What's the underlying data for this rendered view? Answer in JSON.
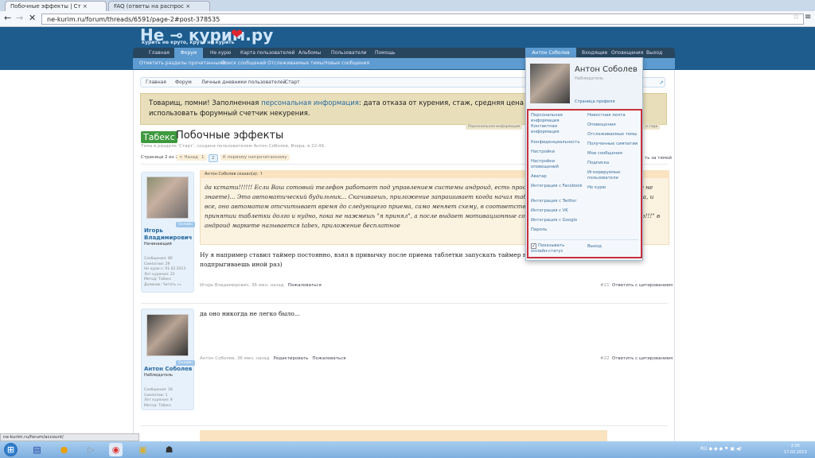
{
  "browser": {
    "tabs": [
      "Побочные эффекты | Ст",
      "FAQ (ответы на распрос"
    ],
    "url": "ne-kurim.ru/forum/threads/6591/page-2#post-378535",
    "status_url": "ne-kurim.ru/forum/account/"
  },
  "site": {
    "logo": "Не ⊸ курим.ру",
    "slogan": "курить не круто, круто не курить"
  },
  "nav": [
    "Главная",
    "Форум",
    "Не курю",
    "Карта пользователей",
    "Альбомы",
    "Пользователи",
    "Помощь"
  ],
  "user_nav": {
    "user": "Антон Соболев",
    "inbox": "Входящие",
    "alerts": "Оповещения",
    "logout": "Выход"
  },
  "subnav": [
    "Отметить разделы прочитанными",
    "Поиск сообщений",
    "Отслеживаемые темы",
    "Новые сообщения"
  ],
  "breadcrumb": [
    "Главная",
    "Форум",
    "Личные дневники пользователей",
    "Старт"
  ],
  "notice": {
    "before": "Товарищ, помни! Заполненная ",
    "link": "персональная информация",
    "after": ": дата отказа от курения, стаж, средняя цена пачки сигарет; позволит использовать форумный счетчик некурения.",
    "tag": "Персональная информация",
    "right_tag": "и года"
  },
  "thread": {
    "prefix": "Табекс",
    "title": "Побочные эффекты",
    "meta": "Тема в разделе 'Старт', создана пользователем Антон Соболев, Вчера, в 22:49.",
    "watch": "ть за темой"
  },
  "pagination": {
    "label": "Страница 2 из 2",
    "prev": "< Назад",
    "pages": [
      "1",
      "2"
    ],
    "first_unread": "К первому непрочитанному"
  },
  "posts": [
    {
      "user": "Игорь Владимирович",
      "role": "Начинающий",
      "online": "Онлайн",
      "stats": [
        "Сообщения: 86",
        "Симпатии: 29",
        "Не курю с: 01.02.2013",
        "Лет курения: 33",
        "Метод: Табекс",
        "Дневник: Читать »»"
      ],
      "quote_head": "Антон Соболев сказал(а): ↑",
      "quote": "да кстати!!!!!! Если Ваш сотовый телефон работает под управлением системы андроид, есть простое приложение для табекса ( вдруг не знаете)... Это автоматический будильник... Скачиваешь, приложение запрашивает когда начал табекс, во сколько начинать курс приема, и все, оно автоматом отсчитывает время до следующего приема, само меняет схему, в соответствии с инструкцией, и напоминает о принятии таблетки долго и нудно, пока не нажмешь \"я принял\", а после выдает мотивационные сообщения, типа \"атата, курить плохо!!!\" в андроид маркете называется tabex, приложение бесплатное",
      "text": "Ну я например ставил таймер постоянно, взял в привычку после приема таблетки запускать таймер на 2,5-3 часа, и забывал на него, аж подпрыгиваешь иной раз)",
      "footer": "Игорь Владимирович, 36 мин. назад",
      "actions": [
        "Пожаловаться"
      ],
      "num": "#21",
      "reply": "Ответить с цитированием"
    },
    {
      "user": "Антон Соболев",
      "role": "Наблюдатель",
      "online": "Онлайн",
      "stats": [
        "Сообщения: 18",
        "Симпатии: 1",
        "Лет курения: 9",
        "Метод: Табекс"
      ],
      "text": "да оно никогда не легко было...",
      "footer": "Антон Соболев, 36 мин. назад",
      "actions": [
        "Редактировать",
        "Пожаловаться"
      ],
      "num": "#22",
      "reply": "Ответить с цитированием"
    }
  ],
  "popup": {
    "name": "Антон Соболев",
    "role": "Наблюдатель",
    "profile": "Страница профиля",
    "left": [
      "Персональная информация",
      "Контактная информация",
      "Конфиденциальность",
      "Настройки",
      "Настройки оповещений",
      "Аватар",
      "Интеграция с Facebook",
      "Интеграция с Twitter",
      "Интеграция с VK",
      "Интеграция с Google",
      "Пароль"
    ],
    "right": [
      "Новостная лента",
      "Оповещения",
      "Отслеживаемые темы",
      "Полученные симпатии",
      "Мои сообщения",
      "Подписка",
      "Игнорируемые пользователи",
      "Не курю"
    ],
    "show_online": "Показывать онлайн-статус",
    "logout": "Выход"
  },
  "clock": {
    "time": "2:05",
    "date": "17.02.2013"
  },
  "colors": {
    "header": "#1d5c8d",
    "highlight": "#c8303c"
  }
}
